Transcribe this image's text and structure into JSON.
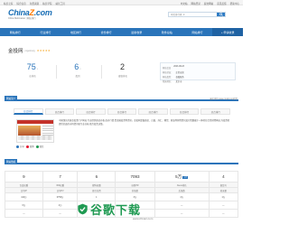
{
  "topbar": {
    "left_links": [
      "站长之家",
      "综合信息",
      "免费资源",
      "站长学院",
      "站长工具"
    ],
    "right_links": [
      "中文站",
      "网站登录",
      "提交网站",
      "意见反馈",
      "帮助中心"
    ]
  },
  "logo": {
    "main_prefix": "China",
    "main_z": "Z",
    "main_suffix": ".com",
    "sub": "China Webmaster | 网站排行"
  },
  "search": {
    "scope": "中文排行榜",
    "arrow": "▼",
    "button_icon": "🔍"
  },
  "nav": {
    "items": [
      "网站排行",
      "行业排行",
      "地区排行",
      "省份排行",
      "最新收录",
      "软件总站",
      "网站排行",
      "+ 申请收录"
    ]
  },
  "site": {
    "name": "金投网",
    "domain": "cngold.org",
    "stars": "★★★★★"
  },
  "stats": [
    {
      "value": "75",
      "suffix": "↓",
      "label": "总排名"
    },
    {
      "value": "6",
      "suffix": "↓",
      "label": "类别"
    },
    {
      "value": "2",
      "suffix": "",
      "label": "省级排名"
    }
  ],
  "info_panel": {
    "title_label": "网站信息",
    "title_value": "2023-08-23",
    "rows": [
      {
        "k": "网站状态：",
        "v": "正常运营"
      },
      {
        "k": "网站类型：",
        "v": "金融服务"
      },
      {
        "k": "所属地区：",
        "v": "北京市"
      }
    ]
  },
  "intro_section": {
    "tag": "网站简介",
    "right": "最近更新 www.cngold.org提供"
  },
  "tabs": [
    "综合排行",
    "综合排行",
    "综合排行",
    "综合排行",
    "综合排行",
    "综合排行",
    "综合排行"
  ],
  "description": "中国领先的黄金投资门户网站,专业提供黄金价格,金价行情,贵金属投资等资讯。金投网是集黄金、白银、外汇、期货、原油等财经资讯及行情数据于一体的综合性财经网站,为投资者提供全面的市场资讯和专业分析,助力投资决策。",
  "share": [
    {
      "icon": "share-icon",
      "label": "分享",
      "color": "#2a74ba"
    },
    {
      "icon": "weibo-icon",
      "label": "微博",
      "color": "#e6162d"
    },
    {
      "icon": "wechat-icon",
      "label": "微信",
      "color": "#1f9a52"
    }
  ],
  "data_section": {
    "tag": "网站数据"
  },
  "data_table": {
    "headers": [
      "百度权重",
      "360权重",
      "搜狗权重",
      "谷歌PR",
      "Alexa排名",
      "备案号"
    ],
    "values": [
      {
        "v": "9",
        "badge": ""
      },
      {
        "v": "7",
        "badge": ""
      },
      {
        "v": "6",
        "badge": ""
      },
      {
        "v": "7093",
        "badge": ""
      },
      {
        "v": "5万",
        "badge": "↓1万"
      },
      {
        "v": "4",
        "badge": ""
      }
    ],
    "sub_headers": [
      "日均IP",
      "日均PV",
      "首页位置",
      "外链数",
      "反链数",
      "收录量"
    ],
    "rows": [
      [
        "410万",
        "6756万",
        "1",
        "3万",
        "4万",
        "1万"
      ],
      [
        "6万",
        "4万",
        "36",
        "—",
        "—",
        "—"
      ],
      [
        "—",
        "—",
        "—",
        "—",
        "—",
        "—"
      ]
    ]
  },
  "watermark": {
    "text": "谷歌下载",
    "url": "www.chinaz.com"
  }
}
